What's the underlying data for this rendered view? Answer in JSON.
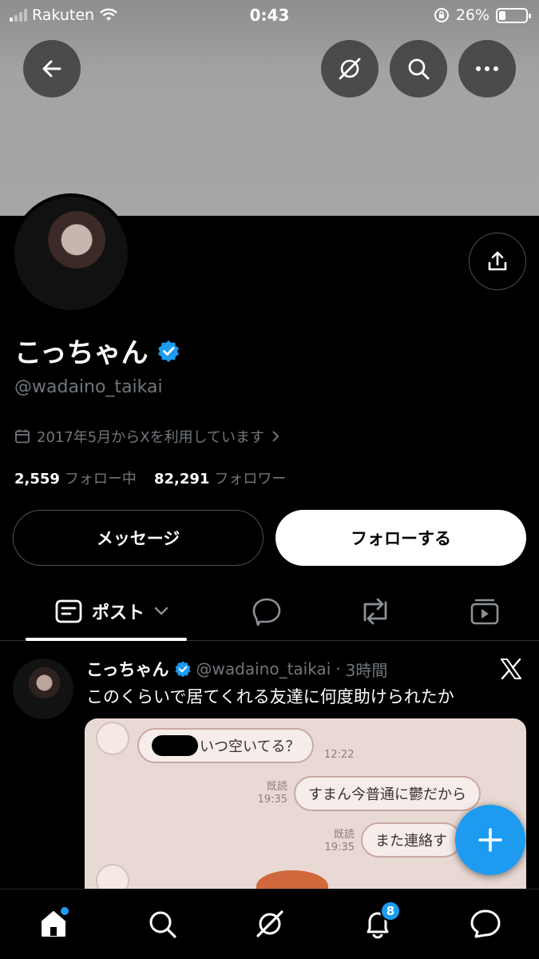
{
  "status_bar": {
    "carrier": "Rakuten",
    "time": "0:43",
    "battery": "26%",
    "battery_level": 0.26
  },
  "profile": {
    "display_name": "こっちゃん",
    "handle": "@wadaino_taikai",
    "joined": "2017年5月からXを利用しています",
    "following_count": "2,559",
    "following_label": "フォロー中",
    "followers_count": "82,291",
    "followers_label": "フォロワー",
    "message_label": "メッセージ",
    "follow_label": "フォローする"
  },
  "tabs": [
    {
      "label": "ポスト",
      "icon": "posts-icon",
      "active": true
    },
    {
      "icon": "reply-icon"
    },
    {
      "icon": "repost-icon"
    },
    {
      "icon": "media-icon"
    }
  ],
  "post": {
    "name": "こっちゃん",
    "handle": "@wadaino_taikai",
    "separator": "·",
    "time": "3時間",
    "text": "このくらいで居てくれる友達に何度助けられたか",
    "image": {
      "bubble1": "いつ空いてる？",
      "bubble1_time": "12:22",
      "read_label": "既読",
      "bubble2": "すまん今普通に鬱だから",
      "bubble2_time": "19:35",
      "bubble3": "また連絡す",
      "bubble3_time": "19:35"
    }
  },
  "nav": {
    "notification_count": "8"
  },
  "colors": {
    "accent": "#1d9bf0",
    "background": "#000000",
    "muted": "#71767b"
  }
}
